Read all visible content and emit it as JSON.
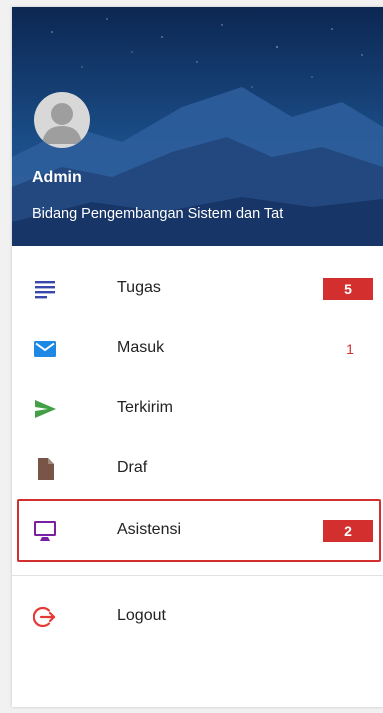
{
  "header": {
    "user_name": "Admin",
    "department": "Bidang Pengembangan Sistem dan Tat"
  },
  "menu": [
    {
      "label": "Tugas",
      "icon": "list-lines-icon",
      "color": "#3949ab",
      "badge": "5",
      "badge_style": "filled"
    },
    {
      "label": "Masuk",
      "icon": "mail-icon",
      "color": "#1e88e5",
      "badge": "1",
      "badge_style": "plain"
    },
    {
      "label": "Terkirim",
      "icon": "send-icon",
      "color": "#43a047",
      "badge": "",
      "badge_style": ""
    },
    {
      "label": "Draf",
      "icon": "document-icon",
      "color": "#795548",
      "badge": "",
      "badge_style": ""
    },
    {
      "label": "Asistensi",
      "icon": "monitor-icon",
      "color": "#7b1fa2",
      "badge": "2",
      "badge_style": "filled",
      "selected": true
    }
  ],
  "logout": {
    "label": "Logout",
    "icon": "logout-icon",
    "color": "#e53935"
  },
  "colors": {
    "accent_red": "#d32f2f",
    "header_sky_top": "#0d2a55",
    "header_mountain": "#3a63a0"
  }
}
